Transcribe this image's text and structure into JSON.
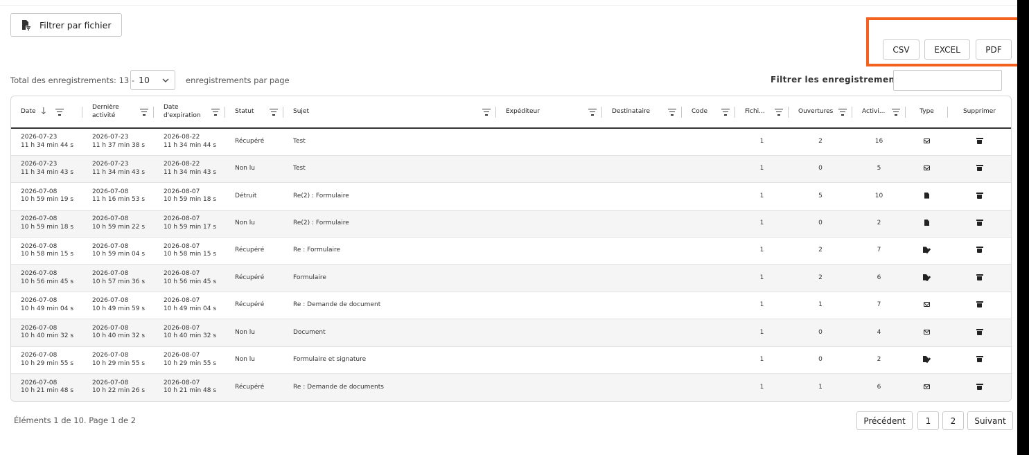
{
  "toolbar": {
    "filter_file_label": "Filtrer par fichier",
    "filter_file_icon": "file-filter-icon"
  },
  "export": {
    "csv": "CSV",
    "excel": "EXCEL",
    "pdf": "PDF",
    "highlight_color": "#f4621f"
  },
  "records": {
    "total_label": "Total des enregistrements: 13 -",
    "page_size": "10",
    "per_page_label": "enregistrements par page",
    "filter_label": "Filtrer les enregistrements",
    "filter_value": ""
  },
  "table": {
    "headers": [
      "Date",
      "Dernière activité",
      "Date d'expiration",
      "Statut",
      "Sujet",
      "Expéditeur",
      "Destinataire",
      "Code",
      "Fichi...",
      "Ouvertures",
      "Activi...",
      "Type",
      "Supprimer"
    ],
    "rows": [
      {
        "date": "2026-07-23",
        "date_time": "11 h 34 min 44 s",
        "last": "2026-07-23",
        "last_time": "11 h 37 min 38 s",
        "exp": "2026-08-22",
        "exp_time": "11 h 34 min 44 s",
        "status": "Récupéré",
        "subject": "Test",
        "sender": "",
        "recipient": "",
        "code": "",
        "files": "1",
        "opens": "2",
        "activity": "16",
        "type": "mail-icon"
      },
      {
        "date": "2026-07-23",
        "date_time": "11 h 34 min 43 s",
        "last": "2026-07-23",
        "last_time": "11 h 34 min 43 s",
        "exp": "2026-08-22",
        "exp_time": "11 h 34 min 43 s",
        "status": "Non lu",
        "subject": "Test",
        "sender": "",
        "recipient": "",
        "code": "",
        "files": "1",
        "opens": "0",
        "activity": "5",
        "type": "mail-icon"
      },
      {
        "date": "2026-07-08",
        "date_time": "10 h 59 min 19 s",
        "last": "2026-07-08",
        "last_time": "11 h 16 min 53 s",
        "exp": "2026-08-07",
        "exp_time": "10 h 59 min 18 s",
        "status": "Détruit",
        "subject": "Re(2) : Formulaire",
        "sender": "",
        "recipient": "",
        "code": "",
        "files": "1",
        "opens": "5",
        "activity": "10",
        "type": "document-icon"
      },
      {
        "date": "2026-07-08",
        "date_time": "10 h 59 min 18 s",
        "last": "2026-07-08",
        "last_time": "10 h 59 min 22 s",
        "exp": "2026-08-07",
        "exp_time": "10 h 59 min 17 s",
        "status": "Non lu",
        "subject": "Re(2) : Formulaire",
        "sender": "",
        "recipient": "",
        "code": "",
        "files": "1",
        "opens": "0",
        "activity": "2",
        "type": "document-icon"
      },
      {
        "date": "2026-07-08",
        "date_time": "10 h 58 min 15 s",
        "last": "2026-07-08",
        "last_time": "10 h 59 min 04 s",
        "exp": "2026-08-07",
        "exp_time": "10 h 58 min 15 s",
        "status": "Récupéré",
        "subject": "Re : Formulaire",
        "sender": "",
        "recipient": "",
        "code": "",
        "files": "1",
        "opens": "2",
        "activity": "7",
        "type": "signature-icon"
      },
      {
        "date": "2026-07-08",
        "date_time": "10 h 56 min 45 s",
        "last": "2026-07-08",
        "last_time": "10 h 57 min 36 s",
        "exp": "2026-08-07",
        "exp_time": "10 h 56 min 45 s",
        "status": "Récupéré",
        "subject": "Formulaire",
        "sender": "",
        "recipient": "",
        "code": "",
        "files": "1",
        "opens": "2",
        "activity": "6",
        "type": "signature-icon"
      },
      {
        "date": "2026-07-08",
        "date_time": "10 h 49 min 04 s",
        "last": "2026-07-08",
        "last_time": "10 h 49 min 59 s",
        "exp": "2026-08-07",
        "exp_time": "10 h 49 min 04 s",
        "status": "Récupéré",
        "subject": "Re : Demande de document",
        "sender": "",
        "recipient": "",
        "code": "",
        "files": "1",
        "opens": "1",
        "activity": "7",
        "type": "mail-icon"
      },
      {
        "date": "2026-07-08",
        "date_time": "10 h 40 min 32 s",
        "last": "2026-07-08",
        "last_time": "10 h 40 min 32 s",
        "exp": "2026-08-07",
        "exp_time": "10 h 40 min 32 s",
        "status": "Non lu",
        "subject": "Document",
        "sender": "",
        "recipient": "",
        "code": "",
        "files": "1",
        "opens": "0",
        "activity": "4",
        "type": "mail-icon"
      },
      {
        "date": "2026-07-08",
        "date_time": "10 h 29 min 55 s",
        "last": "2026-07-08",
        "last_time": "10 h 29 min 55 s",
        "exp": "2026-08-07",
        "exp_time": "10 h 29 min 55 s",
        "status": "Non lu",
        "subject": "Formulaire et signature",
        "sender": "",
        "recipient": "",
        "code": "",
        "files": "1",
        "opens": "0",
        "activity": "2",
        "type": "signature-icon"
      },
      {
        "date": "2026-07-08",
        "date_time": "10 h 21 min 48 s",
        "last": "2026-07-08",
        "last_time": "10 h 22 min 26 s",
        "exp": "2026-08-07",
        "exp_time": "10 h 21 min 48 s",
        "status": "Récupéré",
        "subject": "Re : Demande de documents",
        "sender": "",
        "recipient": "",
        "code": "",
        "files": "1",
        "opens": "1",
        "activity": "6",
        "type": "mail-icon"
      }
    ]
  },
  "footer": {
    "summary": "Éléments 1 de 10. Page 1 de 2",
    "prev": "Précédent",
    "page1": "1",
    "page2": "2",
    "next": "Suivant"
  }
}
